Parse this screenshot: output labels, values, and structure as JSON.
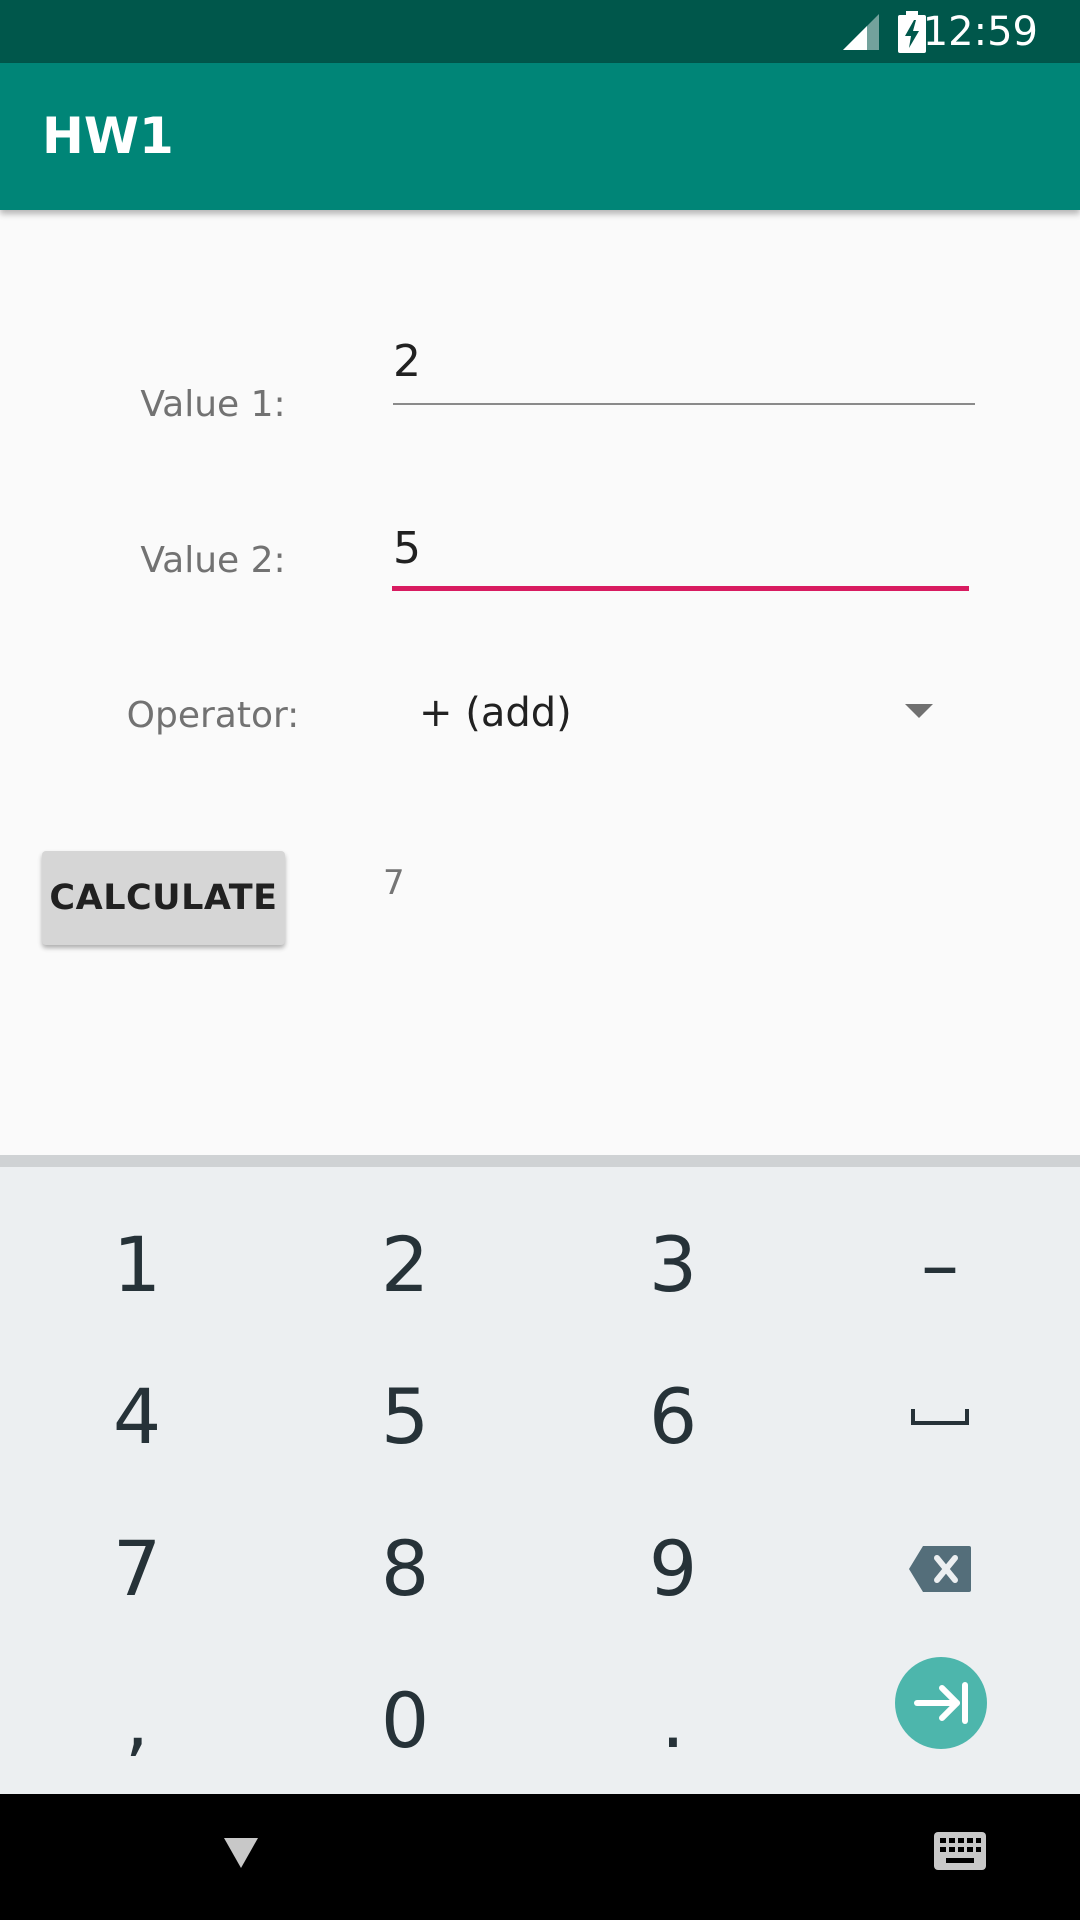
{
  "status_bar": {
    "time": "12:59",
    "signal_icon": "cell-signal-icon",
    "battery_icon": "battery-charging-icon"
  },
  "app_bar": {
    "title": "HW1",
    "color": "#008577"
  },
  "form": {
    "value1": {
      "label": "Value 1:",
      "value": "2"
    },
    "value2": {
      "label": "Value 2:",
      "value": "5"
    },
    "operator": {
      "label": "Operator:",
      "selected": "+ (add)"
    },
    "calculate_button": "CALCULATE",
    "result": "7"
  },
  "keyboard": {
    "rows": [
      [
        "1",
        "2",
        "3",
        "–"
      ],
      [
        "4",
        "5",
        "6",
        "space-key-icon"
      ],
      [
        "7",
        "8",
        "9",
        "backspace-icon"
      ],
      [
        ",",
        "0",
        ".",
        "next-field-icon"
      ]
    ],
    "enter_color": "#4db6ac"
  },
  "nav_bar": {
    "back_icon": "back-triangle-icon",
    "keyboard_icon": "keyboard-switch-icon"
  }
}
